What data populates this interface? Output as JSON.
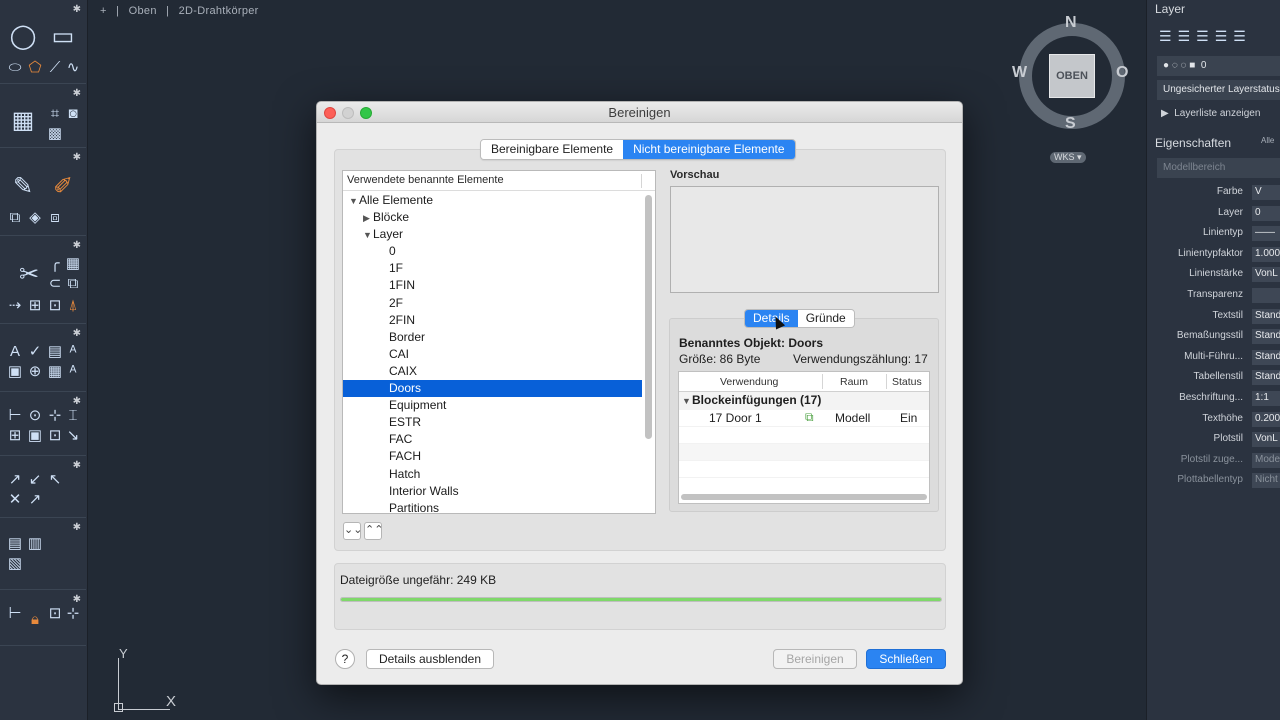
{
  "viewport": {
    "plus": "+",
    "view": "Oben",
    "style": "2D-Drahtkörper"
  },
  "ucs": {
    "x": "X",
    "y": "Y"
  },
  "viewcube": {
    "face": "OBEN",
    "n": "N",
    "s": "S",
    "w": "W",
    "o": "O",
    "wks": "WKS"
  },
  "right_panel": {
    "layer_title": "Layer",
    "current_layer": "0",
    "layer_state": "Ungesicherter Layerstatus",
    "layer_list_link": "Layerliste anzeigen",
    "props_title": "Eigenschaften",
    "props_filter": "Alle",
    "model_space": "Modellbereich",
    "properties": [
      {
        "label": "Farbe",
        "value": "V"
      },
      {
        "label": "Layer",
        "value": "0"
      },
      {
        "label": "Linientyp",
        "value": "——"
      },
      {
        "label": "Linientypfaktor",
        "value": "1.000"
      },
      {
        "label": "Linienstärke",
        "value": "VonL"
      },
      {
        "label": "Transparenz",
        "value": ""
      },
      {
        "label": "Textstil",
        "value": "Stand"
      },
      {
        "label": "Bemaßungsstil",
        "value": "Stand"
      },
      {
        "label": "Multi-Führu...",
        "value": "Stand"
      },
      {
        "label": "Tabellenstil",
        "value": "Stand"
      },
      {
        "label": "Beschriftung...",
        "value": "1:1"
      },
      {
        "label": "Texthöhe",
        "value": "0.200"
      },
      {
        "label": "Plotstil",
        "value": "VonL"
      },
      {
        "label": "Plotstil zuge...",
        "value": "Modell"
      },
      {
        "label": "Plottabellentyp",
        "value": "Nicht"
      }
    ]
  },
  "dialog": {
    "title": "Bereinigen",
    "tabs": [
      "Bereinigbare Elemente",
      "Nicht bereinigbare Elemente"
    ],
    "active_tab": "Nicht bereinigbare Elemente",
    "tree_header": "Verwendete benannte Elemente",
    "tree": {
      "root": "Alle Elemente",
      "blocks": "Blöcke",
      "layer": "Layer",
      "layers": [
        "0",
        "1F",
        "1FIN",
        "2F",
        "2FIN",
        "Border",
        "CAI",
        "CAIX",
        "Doors",
        "Equipment",
        "ESTR",
        "FAC",
        "FACH",
        "Hatch",
        "Interior Walls",
        "Partitions"
      ],
      "selected": "Doors"
    },
    "preview_label": "Vorschau",
    "detail_tabs": [
      "Details",
      "Gründe"
    ],
    "detail_active": "Details",
    "object_name": "Benanntes Objekt: Doors",
    "size": "Größe: 86 Byte",
    "usage_count": "Verwendungszählung: 17",
    "usage_columns": [
      "Verwendung",
      "Raum",
      "Status"
    ],
    "usage_group": "Blockeinfügungen (17)",
    "usage_rows": [
      {
        "name": "17 Door 1",
        "raum": "Modell",
        "status": "Ein"
      }
    ],
    "filesize": "Dateigröße ungefähr: 249 KB",
    "progress": 1.0,
    "help": "?",
    "hide_details": "Details ausblenden",
    "purge": "Bereinigen",
    "close": "Schließen"
  }
}
